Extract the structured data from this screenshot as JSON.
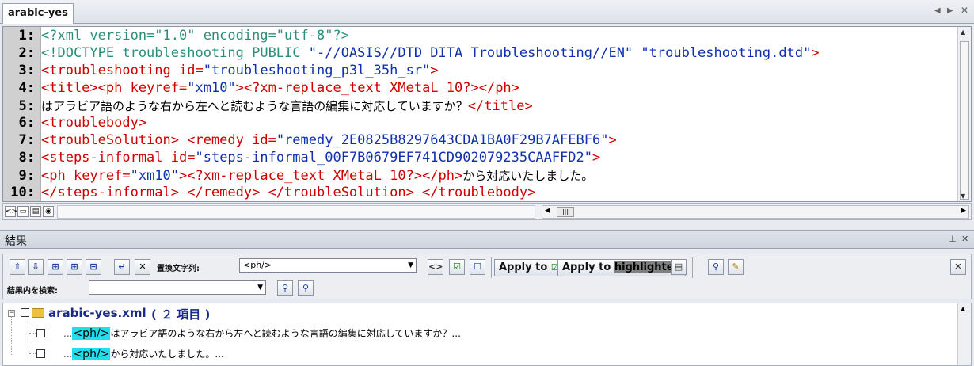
{
  "editor": {
    "tab_label": "arabic-yes",
    "lines": [
      {
        "num": "1:",
        "segments": [
          {
            "cls": "pi",
            "text": "<?xml version=\"1.0\" encoding=\"utf-8\"?>"
          }
        ]
      },
      {
        "num": "2:",
        "segments": [
          {
            "cls": "pi",
            "text": "<!DOCTYPE troubleshooting PUBLIC "
          },
          {
            "cls": "val",
            "text": "\"-//OASIS//DTD DITA Troubleshooting//EN\" \"troubleshooting.dtd\""
          },
          {
            "cls": "tag",
            "text": ">"
          }
        ]
      },
      {
        "num": "3:",
        "segments": [
          {
            "cls": "tag",
            "text": "<troubleshooting "
          },
          {
            "cls": "attr",
            "text": "id="
          },
          {
            "cls": "val",
            "text": "\"troubleshooting_p3l_35h_sr\""
          },
          {
            "cls": "tag",
            "text": ">"
          }
        ]
      },
      {
        "num": "4:",
        "segments": [
          {
            "cls": "tag",
            "text": "<title><ph "
          },
          {
            "cls": "attr",
            "text": "keyref="
          },
          {
            "cls": "val",
            "text": "\"xm10\""
          },
          {
            "cls": "tag",
            "text": "><?xm-replace_text XMetaL 10?></ph>"
          }
        ]
      },
      {
        "num": "5:",
        "segments": [
          {
            "cls": "txt",
            "text": "はアラビア語のような右から左へと読むような言語の編集に対応していますか？"
          },
          {
            "cls": "tag",
            "text": "</title>"
          }
        ]
      },
      {
        "num": "6:",
        "segments": [
          {
            "cls": "tag",
            "text": "<troublebody>"
          }
        ]
      },
      {
        "num": "7:",
        "segments": [
          {
            "cls": "tag",
            "text": "<troubleSolution> <remedy "
          },
          {
            "cls": "attr",
            "text": "id="
          },
          {
            "cls": "val",
            "text": "\"remedy_2E0825B8297643CDA1BA0F29B7AFEBF6\""
          },
          {
            "cls": "tag",
            "text": ">"
          }
        ]
      },
      {
        "num": "8:",
        "segments": [
          {
            "cls": "tag",
            "text": "<steps-informal "
          },
          {
            "cls": "attr",
            "text": "id="
          },
          {
            "cls": "val",
            "text": "\"steps-informal_00F7B0679EF741CD902079235CAAFFD2\""
          },
          {
            "cls": "tag",
            "text": ">"
          }
        ]
      },
      {
        "num": "9:",
        "segments": [
          {
            "cls": "tag",
            "text": "<ph "
          },
          {
            "cls": "attr",
            "text": "keyref="
          },
          {
            "cls": "val",
            "text": "\"xm10\""
          },
          {
            "cls": "tag",
            "text": "><?xm-replace_text XMetaL 10?></ph>"
          },
          {
            "cls": "txt",
            "text": "から対応いたしました。"
          }
        ]
      },
      {
        "num": "10:",
        "segments": [
          {
            "cls": "tag",
            "text": "</steps-informal> </remedy> </troubleSolution> </troublebody>"
          }
        ]
      }
    ]
  },
  "results": {
    "panel_title": "結果",
    "replace_label": "置換文字列:",
    "replace_value": "<ph/>",
    "search_in_results_label": "結果内を検索:",
    "search_in_results_value": "",
    "apply_to_label": "Apply to",
    "apply_to_highlighted_prefix": "Apply to",
    "apply_to_highlighted_word": "highlighted",
    "file_node": {
      "name": "arabic-yes.xml",
      "count_text": "( ２ 項目 )"
    },
    "hits": [
      {
        "prefix": "...",
        "match": "<ph/>",
        "rest": "はアラビア語のような右から左へと読むような言語の編集に対応していますか？..."
      },
      {
        "prefix": "...",
        "match": "<ph/>",
        "rest": "から対応いたしました。..."
      }
    ]
  }
}
